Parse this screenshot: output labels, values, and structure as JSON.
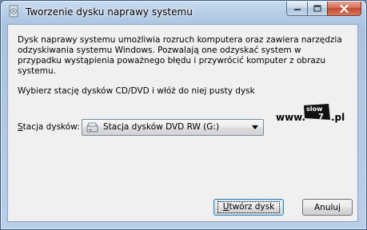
{
  "window": {
    "title": "Tworzenie dysku naprawy systemu"
  },
  "caption_buttons": {
    "minimize_icon": "minimize-icon",
    "maximize_icon": "maximize-icon",
    "close_icon": "close-icon"
  },
  "content": {
    "description": "Dysk naprawy systemu umożliwia rozruch komputera oraz zawiera narzędzia odzyskiwania systemu Windows. Pozwalają one odzyskać system w przypadku wystąpienia poważnego błędu i przywrócić komputer z obrazu systemu.",
    "instruction": "Wybierz stację dysków CD/DVD i włóż do niej pusty dysk",
    "watermark": {
      "prefix": "www.",
      "badge_text": "slow",
      "badge_number": "7",
      "suffix": ".pl"
    },
    "drive_label_first": "S",
    "drive_label_rest": "tacja dysków:",
    "drive_selected": "Stacja dysków DVD RW (G:)"
  },
  "buttons": {
    "create_first": "U",
    "create_rest": "twórz dysk",
    "cancel": "Anuluj"
  },
  "colors": {
    "title_bar": "#b4cce6",
    "client_bg": "#f0f0f0",
    "close_button": "#c1482f",
    "primary_button_border": "#3c7fb1"
  }
}
